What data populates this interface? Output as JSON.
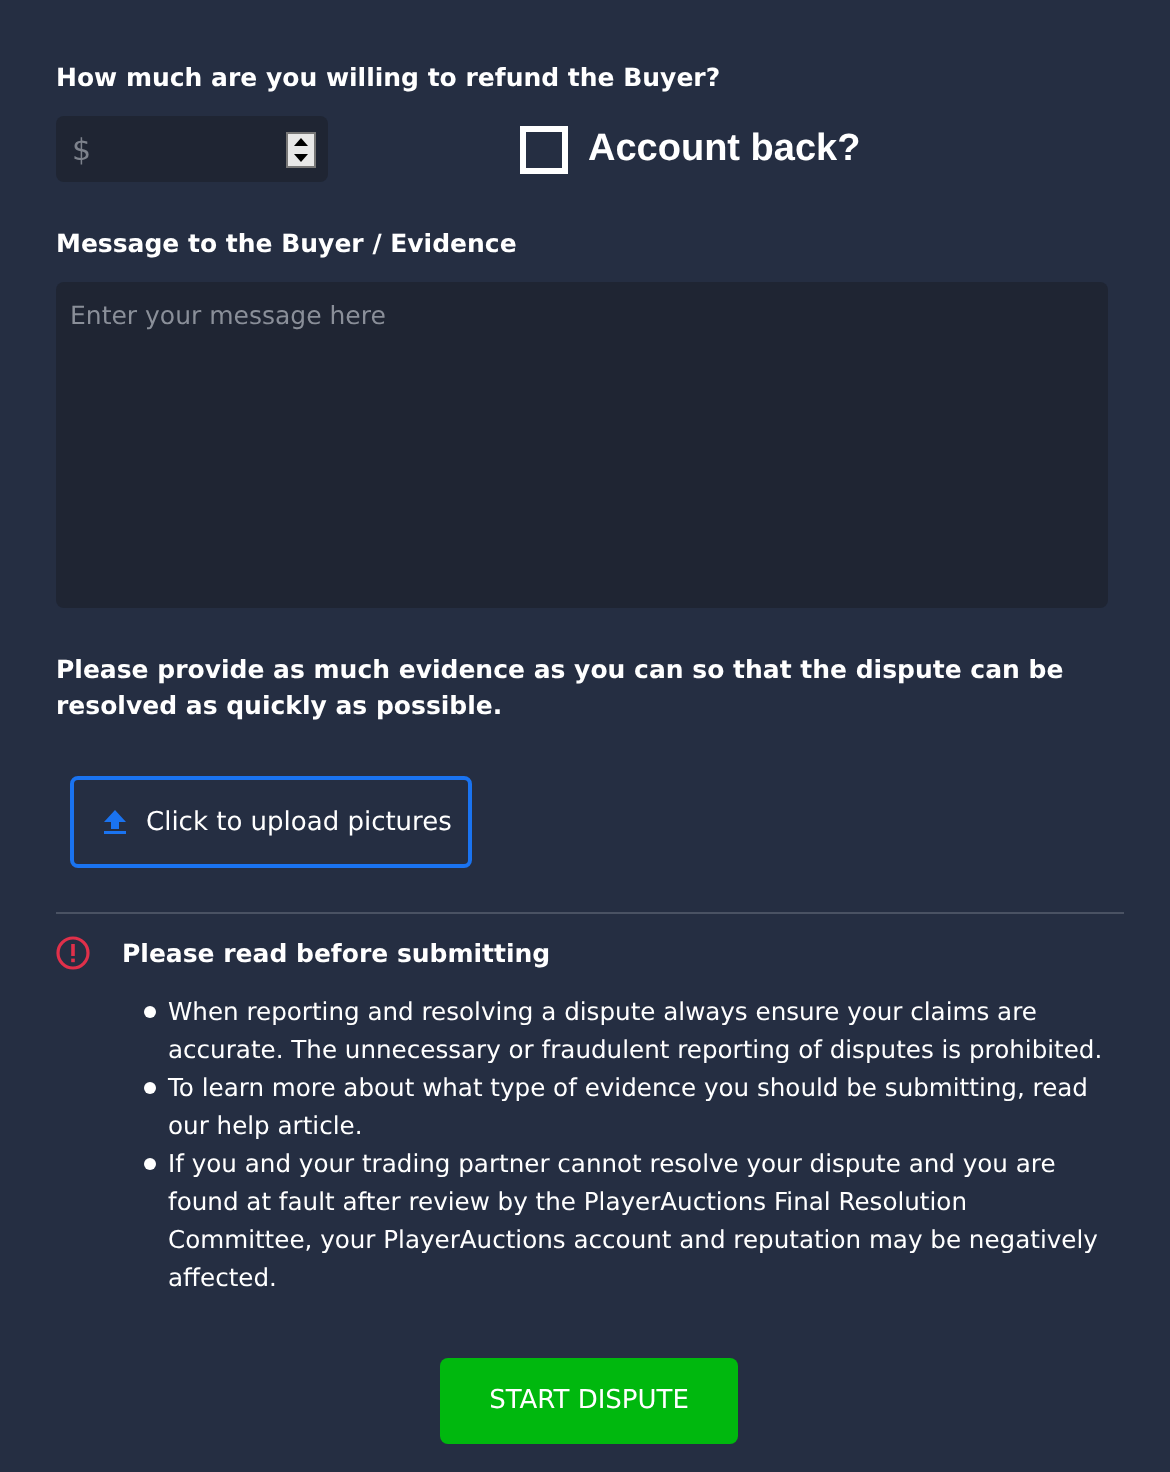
{
  "refund": {
    "label": "How much are you willing to refund the Buyer?",
    "amount": {
      "prefix": "$"
    },
    "account_back": {
      "label": "Account back?",
      "checked": false
    }
  },
  "message": {
    "label": "Message to the Buyer / Evidence",
    "placeholder": "Enter your message here"
  },
  "evidence": {
    "text": "Please provide as much evidence as you can so that the dispute can be resolved as quickly as possible.",
    "upload_button": "Click to upload pictures"
  },
  "notice": {
    "title": "Please read before submitting",
    "items": [
      "When reporting and resolving a dispute always ensure your claims are accurate. The unnecessary or fraudulent reporting of disputes is prohibited.",
      "To learn more about what type of evidence you should be submitting, read our help article.",
      "If you and your trading partner cannot resolve your dispute and you are found at fault after review by the PlayerAuctions Final Resolution Committee, your PlayerAuctions account and reputation may be negatively affected."
    ]
  },
  "submit_button": "START DISPUTE"
}
